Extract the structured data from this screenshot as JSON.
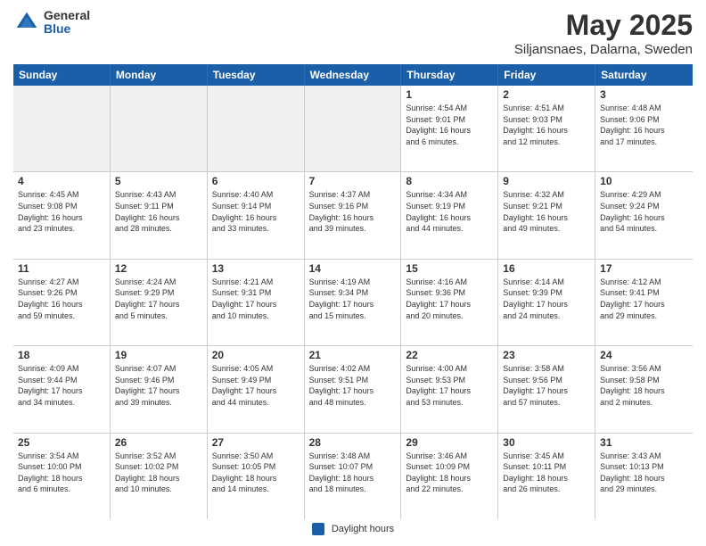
{
  "header": {
    "logo": {
      "general": "General",
      "blue": "Blue"
    },
    "title": "May 2025",
    "subtitle": "Siljansnaes, Dalarna, Sweden"
  },
  "days_of_week": [
    "Sunday",
    "Monday",
    "Tuesday",
    "Wednesday",
    "Thursday",
    "Friday",
    "Saturday"
  ],
  "weeks": [
    [
      {
        "day": "",
        "info": "",
        "shaded": true
      },
      {
        "day": "",
        "info": "",
        "shaded": true
      },
      {
        "day": "",
        "info": "",
        "shaded": true
      },
      {
        "day": "",
        "info": "",
        "shaded": true
      },
      {
        "day": "1",
        "info": "Sunrise: 4:54 AM\nSunset: 9:01 PM\nDaylight: 16 hours\nand 6 minutes.",
        "shaded": false
      },
      {
        "day": "2",
        "info": "Sunrise: 4:51 AM\nSunset: 9:03 PM\nDaylight: 16 hours\nand 12 minutes.",
        "shaded": false
      },
      {
        "day": "3",
        "info": "Sunrise: 4:48 AM\nSunset: 9:06 PM\nDaylight: 16 hours\nand 17 minutes.",
        "shaded": false
      }
    ],
    [
      {
        "day": "4",
        "info": "Sunrise: 4:45 AM\nSunset: 9:08 PM\nDaylight: 16 hours\nand 23 minutes.",
        "shaded": false
      },
      {
        "day": "5",
        "info": "Sunrise: 4:43 AM\nSunset: 9:11 PM\nDaylight: 16 hours\nand 28 minutes.",
        "shaded": false
      },
      {
        "day": "6",
        "info": "Sunrise: 4:40 AM\nSunset: 9:14 PM\nDaylight: 16 hours\nand 33 minutes.",
        "shaded": false
      },
      {
        "day": "7",
        "info": "Sunrise: 4:37 AM\nSunset: 9:16 PM\nDaylight: 16 hours\nand 39 minutes.",
        "shaded": false
      },
      {
        "day": "8",
        "info": "Sunrise: 4:34 AM\nSunset: 9:19 PM\nDaylight: 16 hours\nand 44 minutes.",
        "shaded": false
      },
      {
        "day": "9",
        "info": "Sunrise: 4:32 AM\nSunset: 9:21 PM\nDaylight: 16 hours\nand 49 minutes.",
        "shaded": false
      },
      {
        "day": "10",
        "info": "Sunrise: 4:29 AM\nSunset: 9:24 PM\nDaylight: 16 hours\nand 54 minutes.",
        "shaded": false
      }
    ],
    [
      {
        "day": "11",
        "info": "Sunrise: 4:27 AM\nSunset: 9:26 PM\nDaylight: 16 hours\nand 59 minutes.",
        "shaded": false
      },
      {
        "day": "12",
        "info": "Sunrise: 4:24 AM\nSunset: 9:29 PM\nDaylight: 17 hours\nand 5 minutes.",
        "shaded": false
      },
      {
        "day": "13",
        "info": "Sunrise: 4:21 AM\nSunset: 9:31 PM\nDaylight: 17 hours\nand 10 minutes.",
        "shaded": false
      },
      {
        "day": "14",
        "info": "Sunrise: 4:19 AM\nSunset: 9:34 PM\nDaylight: 17 hours\nand 15 minutes.",
        "shaded": false
      },
      {
        "day": "15",
        "info": "Sunrise: 4:16 AM\nSunset: 9:36 PM\nDaylight: 17 hours\nand 20 minutes.",
        "shaded": false
      },
      {
        "day": "16",
        "info": "Sunrise: 4:14 AM\nSunset: 9:39 PM\nDaylight: 17 hours\nand 24 minutes.",
        "shaded": false
      },
      {
        "day": "17",
        "info": "Sunrise: 4:12 AM\nSunset: 9:41 PM\nDaylight: 17 hours\nand 29 minutes.",
        "shaded": false
      }
    ],
    [
      {
        "day": "18",
        "info": "Sunrise: 4:09 AM\nSunset: 9:44 PM\nDaylight: 17 hours\nand 34 minutes.",
        "shaded": false
      },
      {
        "day": "19",
        "info": "Sunrise: 4:07 AM\nSunset: 9:46 PM\nDaylight: 17 hours\nand 39 minutes.",
        "shaded": false
      },
      {
        "day": "20",
        "info": "Sunrise: 4:05 AM\nSunset: 9:49 PM\nDaylight: 17 hours\nand 44 minutes.",
        "shaded": false
      },
      {
        "day": "21",
        "info": "Sunrise: 4:02 AM\nSunset: 9:51 PM\nDaylight: 17 hours\nand 48 minutes.",
        "shaded": false
      },
      {
        "day": "22",
        "info": "Sunrise: 4:00 AM\nSunset: 9:53 PM\nDaylight: 17 hours\nand 53 minutes.",
        "shaded": false
      },
      {
        "day": "23",
        "info": "Sunrise: 3:58 AM\nSunset: 9:56 PM\nDaylight: 17 hours\nand 57 minutes.",
        "shaded": false
      },
      {
        "day": "24",
        "info": "Sunrise: 3:56 AM\nSunset: 9:58 PM\nDaylight: 18 hours\nand 2 minutes.",
        "shaded": false
      }
    ],
    [
      {
        "day": "25",
        "info": "Sunrise: 3:54 AM\nSunset: 10:00 PM\nDaylight: 18 hours\nand 6 minutes.",
        "shaded": false
      },
      {
        "day": "26",
        "info": "Sunrise: 3:52 AM\nSunset: 10:02 PM\nDaylight: 18 hours\nand 10 minutes.",
        "shaded": false
      },
      {
        "day": "27",
        "info": "Sunrise: 3:50 AM\nSunset: 10:05 PM\nDaylight: 18 hours\nand 14 minutes.",
        "shaded": false
      },
      {
        "day": "28",
        "info": "Sunrise: 3:48 AM\nSunset: 10:07 PM\nDaylight: 18 hours\nand 18 minutes.",
        "shaded": false
      },
      {
        "day": "29",
        "info": "Sunrise: 3:46 AM\nSunset: 10:09 PM\nDaylight: 18 hours\nand 22 minutes.",
        "shaded": false
      },
      {
        "day": "30",
        "info": "Sunrise: 3:45 AM\nSunset: 10:11 PM\nDaylight: 18 hours\nand 26 minutes.",
        "shaded": false
      },
      {
        "day": "31",
        "info": "Sunrise: 3:43 AM\nSunset: 10:13 PM\nDaylight: 18 hours\nand 29 minutes.",
        "shaded": false
      }
    ]
  ],
  "footer": {
    "legend_label": "Daylight hours"
  }
}
